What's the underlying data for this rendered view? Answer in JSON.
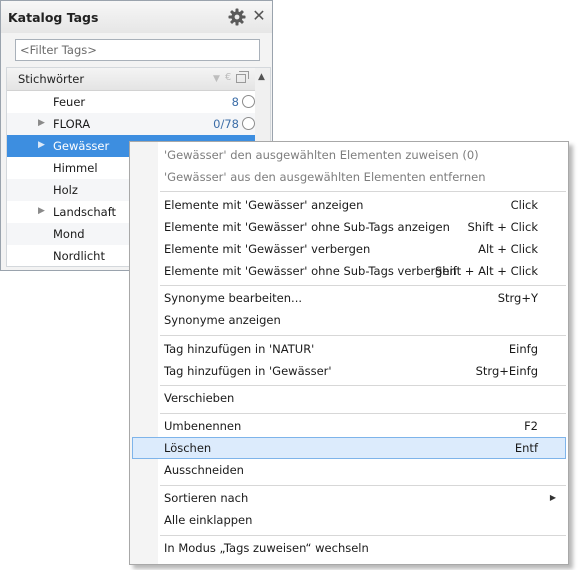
{
  "panel": {
    "title": "Katalog Tags",
    "filter_placeholder": "<Filter Tags>",
    "list_header": "Stichwörter",
    "list_header_extra": "€",
    "rows": [
      {
        "label": "Feuer",
        "count": "8",
        "expandable": false
      },
      {
        "label": "FLORA",
        "count": "0/78",
        "expandable": true
      },
      {
        "label": "Gewässer",
        "count": "",
        "expandable": true
      },
      {
        "label": "Himmel",
        "count": "",
        "expandable": false
      },
      {
        "label": "Holz",
        "count": "",
        "expandable": false
      },
      {
        "label": "Landschaft",
        "count": "",
        "expandable": true
      },
      {
        "label": "Mond",
        "count": "",
        "expandable": false
      },
      {
        "label": "Nordlicht",
        "count": "",
        "expandable": false
      }
    ],
    "selected_row": "Gewässer"
  },
  "context_menu": {
    "groups": [
      [
        {
          "label": "'Gewässer' den ausgewählten Elementen zuweisen (0)",
          "shortcut": "",
          "disabled": true
        },
        {
          "label": "'Gewässer' aus den ausgewählten Elementen entfernen",
          "shortcut": "",
          "disabled": true
        }
      ],
      [
        {
          "label": "Elemente mit 'Gewässer' anzeigen",
          "shortcut": "Click"
        },
        {
          "label": "Elemente mit 'Gewässer' ohne Sub-Tags anzeigen",
          "shortcut": "Shift + Click"
        },
        {
          "label": "Elemente mit 'Gewässer' verbergen",
          "shortcut": "Alt + Click"
        },
        {
          "label": "Elemente mit 'Gewässer' ohne Sub-Tags verbergen",
          "shortcut": "Shift + Alt + Click"
        }
      ],
      [
        {
          "label": "Synonyme bearbeiten...",
          "shortcut": "Strg+Y"
        },
        {
          "label": "Synonyme anzeigen",
          "shortcut": ""
        }
      ],
      [
        {
          "label": "Tag hinzufügen in 'NATUR'",
          "shortcut": "Einfg"
        },
        {
          "label": "Tag hinzufügen in 'Gewässer'",
          "shortcut": "Strg+Einfg"
        }
      ],
      [
        {
          "label": "Verschieben",
          "shortcut": ""
        }
      ],
      [
        {
          "label": "Umbenennen",
          "shortcut": "F2"
        },
        {
          "label": "Löschen",
          "shortcut": "Entf",
          "highlighted": true
        },
        {
          "label": "Ausschneiden",
          "shortcut": ""
        }
      ],
      [
        {
          "label": "Sortieren nach",
          "shortcut": "",
          "submenu": true
        },
        {
          "label": "Alle einklappen",
          "shortcut": ""
        }
      ],
      [
        {
          "label": "In Modus „Tags zuweisen“ wechseln",
          "shortcut": ""
        }
      ]
    ]
  },
  "icons": {
    "gear": "gear-icon",
    "close": "close-icon",
    "expand": "expand-arrow-icon",
    "submenu": "submenu-arrow-icon"
  },
  "colors": {
    "selection": "#3d8ee0",
    "menu_highlight": "#dcebfc",
    "menu_highlight_border": "#7eb4ea",
    "count_text": "#3d6ea8"
  }
}
